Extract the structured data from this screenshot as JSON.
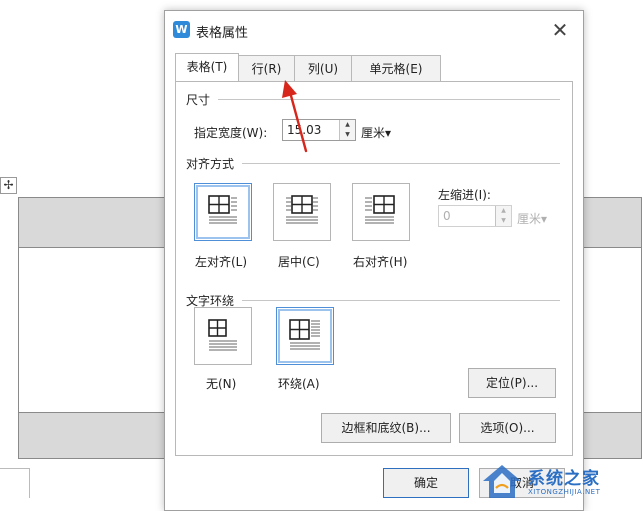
{
  "dialog": {
    "title": "表格属性",
    "app_icon_glyph": "W",
    "close_glyph": "✕"
  },
  "tabs": [
    {
      "label": "表格(T)",
      "active": true
    },
    {
      "label": "行(R)",
      "active": false
    },
    {
      "label": "列(U)",
      "active": false
    },
    {
      "label": "单元格(E)",
      "active": false
    }
  ],
  "size_section": {
    "title": "尺寸",
    "width_label": "指定宽度(W):",
    "width_value": "15.03",
    "unit": "厘米▾"
  },
  "align_section": {
    "title": "对齐方式",
    "options": [
      {
        "label": "左对齐(L)",
        "selected": true
      },
      {
        "label": "居中(C)",
        "selected": false
      },
      {
        "label": "右对齐(H)",
        "selected": false
      }
    ],
    "indent_label": "左缩进(I):",
    "indent_value": "0",
    "indent_unit": "厘米▾"
  },
  "wrap_section": {
    "title": "文字环绕",
    "options": [
      {
        "label": "无(N)",
        "selected": false
      },
      {
        "label": "环绕(A)",
        "selected": true
      }
    ],
    "position_button": "定位(P)..."
  },
  "buttons": {
    "borders": "边框和底纹(B)...",
    "options": "选项(O)...",
    "ok": "确定",
    "cancel": "取消"
  },
  "background": {
    "move_handle_glyph": "✢"
  },
  "watermark": {
    "name": "系统之家",
    "domain": "XITONGZHIJIA.NET"
  },
  "colors": {
    "accent": "#2f8bd9",
    "arrow": "#d7261b",
    "selected_border": "#4f8fd8",
    "watermark": "#2b6fc4"
  }
}
